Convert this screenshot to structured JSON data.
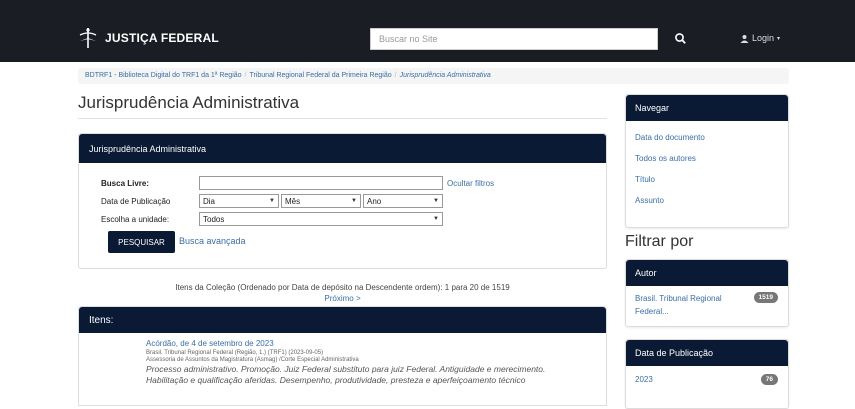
{
  "header": {
    "brand": "JUSTIÇA FEDERAL",
    "search_placeholder": "Buscar no Site",
    "login_label": "Login",
    "bg_color": "#1a1d24"
  },
  "breadcrumb": {
    "items": [
      "BDTRF1 - Biblioteca Digital do TRF1 da 1ª Região",
      "Tribunal Regional Federal da Primeira Região",
      "Jurisprudência Administrativa"
    ]
  },
  "page_title": "Jurisprudência Administrativa",
  "search_panel": {
    "title": "Jurisprudência Administrativa",
    "busca_livre_label": "Busca Livre:",
    "busca_livre_value": "",
    "hide_filters": "Ocultar filtros",
    "data_label": "Data de Publicação",
    "dia": "Dia",
    "mes": "Mês",
    "ano": "Ano",
    "unidade_label": "Escolha a unidade:",
    "unidade_value": "Todos",
    "search_button": "PESQUISAR",
    "advanced_link": "Busca avançada"
  },
  "results": {
    "collection_info": "Itens da Coleção (Ordenado por Data de depósito na Descendente ordem): 1 para 20 de 1519",
    "next": "Próximo >",
    "items_title": "Itens:",
    "items": [
      {
        "title": "Acórdão, de 4 de setembro de 2023",
        "meta": "Brasil. Tribunal Regional Federal (Região, 1.) (TRF1) (2023-09-05)",
        "meta2": "Assessoria de Assuntos da Magistratura (Asmag) /Corte Especial Administrativa",
        "abstract_1": "Processo administrativo. Promoção. Juiz Federal substituto para juiz Federal. Antiguidade e merecimento.",
        "abstract_2": "Habilitação e qualificação aferidas. Desempenho, produtividade, presteza e aperfeiçoamento técnico"
      }
    ]
  },
  "sidebar": {
    "nav_title": "Navegar",
    "nav_items": [
      "Data do documento",
      "Todos os autores",
      "Título",
      "Assunto"
    ],
    "filter_title": "Filtrar por",
    "author_facet_title": "Autor",
    "author_facets": [
      {
        "label": "Brasil. Tribunal Regional Federal...",
        "count": "1519"
      }
    ],
    "date_facet_title": "Data de Publicação",
    "date_facets": [
      {
        "label": "2023",
        "count": "76"
      }
    ]
  },
  "colors": {
    "navy": "#0b1a34",
    "link": "#3a6ea5"
  }
}
